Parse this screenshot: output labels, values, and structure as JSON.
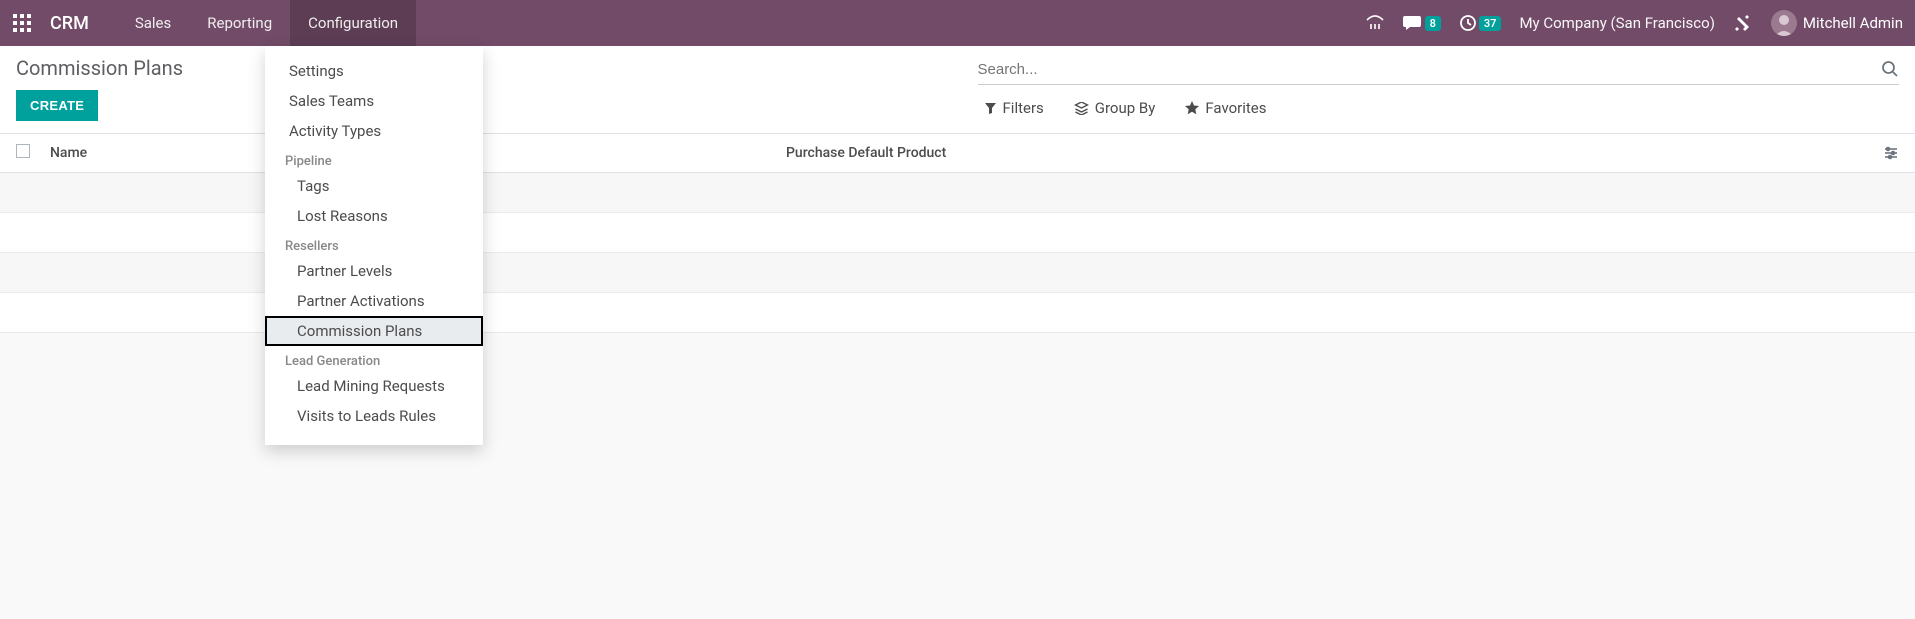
{
  "topnav": {
    "brand": "CRM",
    "items": [
      "Sales",
      "Reporting",
      "Configuration"
    ],
    "active_index": 2,
    "messages_badge": "8",
    "activities_badge": "37",
    "company": "My Company (San Francisco)",
    "user": "Mitchell Admin"
  },
  "page": {
    "title": "Commission Plans",
    "create_label": "CREATE"
  },
  "search": {
    "placeholder": "Search...",
    "filters_label": "Filters",
    "groupby_label": "Group By",
    "favorites_label": "Favorites"
  },
  "list": {
    "columns": [
      "Name",
      "Purchase Default Product"
    ]
  },
  "dropdown": {
    "top_items": [
      "Settings",
      "Sales Teams",
      "Activity Types"
    ],
    "sections": [
      {
        "header": "Pipeline",
        "items": [
          "Tags",
          "Lost Reasons"
        ]
      },
      {
        "header": "Resellers",
        "items": [
          "Partner Levels",
          "Partner Activations",
          "Commission Plans"
        ]
      },
      {
        "header": "Lead Generation",
        "items": [
          "Lead Mining Requests",
          "Visits to Leads Rules"
        ]
      }
    ],
    "selected": "Commission Plans"
  }
}
